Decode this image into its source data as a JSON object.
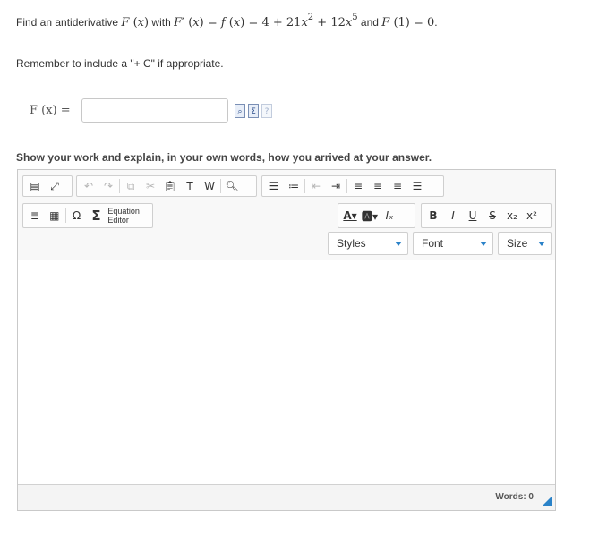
{
  "question": {
    "prefix": "Find an antiderivative ",
    "with": " with ",
    "and": " and ",
    "suffix": "."
  },
  "remember": "Remember to include a \"+ C\" if appropriate.",
  "answer_label": "F (x) =",
  "answer_value": "",
  "instructions": "Show your work and explain, in your own words, how you arrived at your answer.",
  "editor": {
    "equation_editor_label": "Equation Editor",
    "styles_label": "Styles",
    "font_label": "Font",
    "size_label": "Size",
    "words_label": "Words: 0"
  },
  "colors": {
    "accent": "#2a82c8",
    "toolbar_bg": "#f8f8f8",
    "border": "#c9c9c9"
  }
}
